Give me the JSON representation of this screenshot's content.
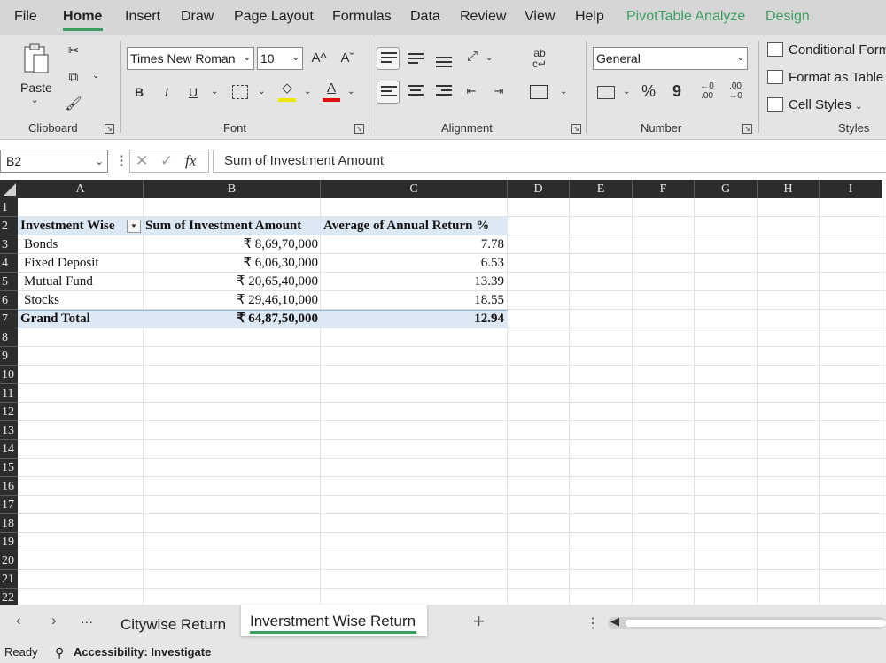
{
  "menu": {
    "items": [
      "File",
      "Home",
      "Insert",
      "Draw",
      "Page Layout",
      "Formulas",
      "Data",
      "Review",
      "View",
      "Help"
    ],
    "context_items": [
      "PivotTable Analyze",
      "Design"
    ],
    "active": "Home"
  },
  "ribbon": {
    "clipboard": {
      "paste_label": "Paste",
      "group_label": "Clipboard"
    },
    "font": {
      "name": "Times New Roman",
      "size": "10",
      "group_label": "Font",
      "bold": "B",
      "italic": "I",
      "underline": "U",
      "grow": "A^",
      "shrink": "Aˇ",
      "font_color_letter": "A"
    },
    "alignment": {
      "group_label": "Alignment"
    },
    "number": {
      "format": "General",
      "group_label": "Number",
      "percent": "%",
      "comma": "9"
    },
    "styles": {
      "group_label": "Styles",
      "conditional": "Conditional Form",
      "format_table": "Format as Table",
      "cell_styles": "Cell Styles"
    }
  },
  "formula_bar": {
    "name_box": "B2",
    "fx": "fx",
    "content": "Sum of  Investment Amount"
  },
  "grid": {
    "columns": [
      "A",
      "B",
      "C",
      "D",
      "E",
      "F",
      "G",
      "H",
      "I"
    ],
    "rows": [
      "1",
      "2",
      "3",
      "4",
      "5",
      "6",
      "7",
      "8",
      "9",
      "10",
      "11",
      "12",
      "13",
      "14",
      "15",
      "16",
      "17",
      "18",
      "19",
      "20",
      "21",
      "22"
    ],
    "pivot": {
      "headers": [
        "Investment Wise",
        "Sum of  Investment Amount",
        "Average of  Annual Return %"
      ],
      "rows": [
        {
          "name": "Bonds",
          "amount": "₹ 8,69,70,000",
          "ret": "7.78"
        },
        {
          "name": "Fixed Deposit",
          "amount": "₹ 6,06,30,000",
          "ret": "6.53"
        },
        {
          "name": "Mutual Fund",
          "amount": "₹ 20,65,40,000",
          "ret": "13.39"
        },
        {
          "name": "Stocks",
          "amount": "₹ 29,46,10,000",
          "ret": "18.55"
        }
      ],
      "total": {
        "name": "Grand Total",
        "amount": "₹ 64,87,50,000",
        "ret": "12.94"
      }
    }
  },
  "sheet_tabs": {
    "tabs": [
      "Citywise Return",
      "Inverstment Wise Return"
    ],
    "active": "Inverstment Wise Return",
    "add": "+",
    "more": "···"
  },
  "status": {
    "ready": "Ready",
    "accessibility": "Accessibility: Investigate"
  }
}
